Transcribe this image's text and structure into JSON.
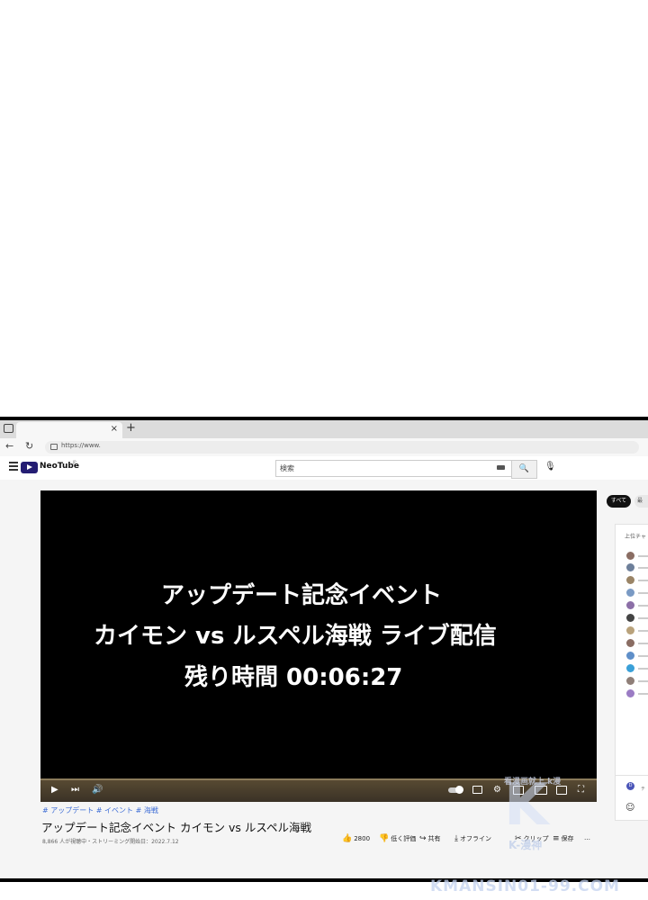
{
  "browser": {
    "tab_close": "×",
    "new_tab": "+",
    "url": "https://www."
  },
  "site": {
    "logo_text": "NeoTube",
    "logo_sup": "JP",
    "search_placeholder": "検索"
  },
  "player": {
    "title_line1": "アップデート記念イベント",
    "title_line2": "カイモン vs ルスペル海戦 ライブ配信",
    "title_line3": "残り時間 00:06:27"
  },
  "video": {
    "tags": "# アップデート # イベント # 海戦",
    "title": "アップデート記念イベント カイモン vs ルスペル海戦",
    "meta": "8,866 人が視聴中・ストリーミング開始日：2022.7.12",
    "actions": {
      "like_count": "2800",
      "dislike": "低く評価",
      "share": "共有",
      "offline": "オフライン",
      "clip": "クリップ",
      "save": "保存",
      "more": "…"
    }
  },
  "chat": {
    "chip_all": "すべて",
    "chip_other": "最",
    "header": "上位チャ",
    "input_hint": "チ",
    "me_avatar": "D"
  },
  "watermark": {
    "small": "看漫画就上 k漫",
    "mid": "K-漫神",
    "url": "KMANSIN01-99.COM"
  }
}
